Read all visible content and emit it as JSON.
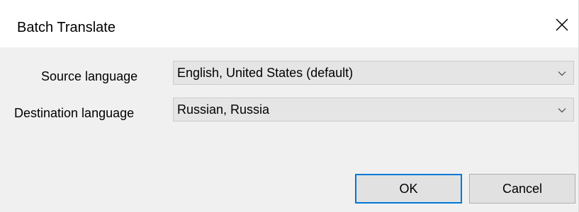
{
  "window": {
    "title": "Batch Translate",
    "close_icon": "close-icon"
  },
  "form": {
    "source": {
      "label": "Source language",
      "value": "English, United States (default)",
      "icon": "chevron-down-icon"
    },
    "destination": {
      "label": "Destination language",
      "value": "Russian, Russia",
      "icon": "chevron-down-icon"
    }
  },
  "buttons": {
    "ok_label": "OK",
    "cancel_label": "Cancel"
  },
  "colors": {
    "accent": "#0078d7",
    "dialog_bg": "#f0f0f0",
    "combo_bg": "#e5e5e5",
    "button_bg": "#e1e1e1"
  }
}
